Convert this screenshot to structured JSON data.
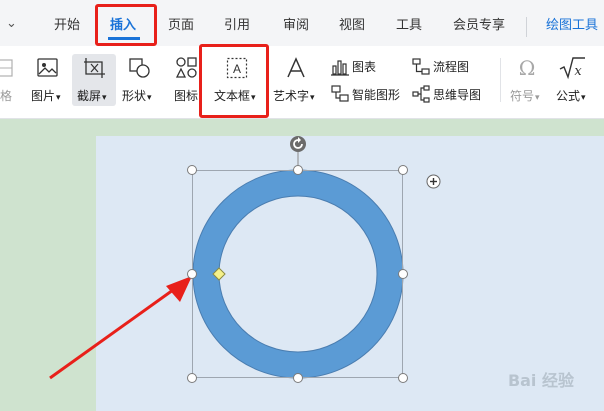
{
  "tabs": [
    {
      "label": "开始"
    },
    {
      "label": "插入",
      "active": true
    },
    {
      "label": "页面"
    },
    {
      "label": "引用"
    },
    {
      "label": "审阅"
    },
    {
      "label": "视图"
    },
    {
      "label": "工具"
    },
    {
      "label": "会员专享"
    },
    {
      "label": "绘图工具"
    }
  ],
  "ribbon": {
    "partial_left_label": "格",
    "picture": "图片",
    "screenshot": "截屏",
    "shape": "形状",
    "icon": "图标",
    "textbox": "文本框",
    "wordart": "艺术字",
    "chart": "图表",
    "smartart": "智能图形",
    "flowchart": "流程图",
    "mindmap": "思维导图",
    "symbol": "符号",
    "formula": "公式"
  },
  "colors": {
    "accent": "#1a73d8",
    "highlight_box": "#e8201a",
    "ring_fill": "#5b9bd5",
    "page_bg": "#dde8f4",
    "workspace_bg": "#cfe3cf"
  },
  "watermark": "Bai 经验"
}
